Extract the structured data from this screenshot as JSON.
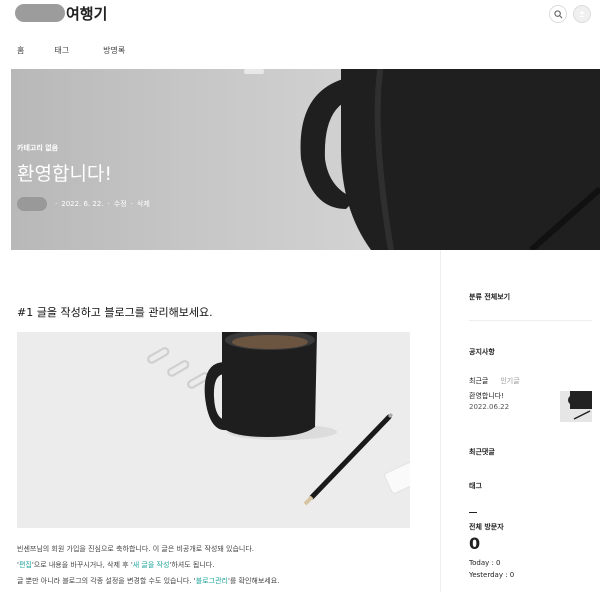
{
  "header": {
    "blog_title": "여행기",
    "search_icon": "search-icon",
    "profile_icon": "profile-icon"
  },
  "nav": {
    "items": [
      "홈",
      "태그",
      "방명록"
    ]
  },
  "hero": {
    "category": "카테고리 없음",
    "title": "환영합니다!",
    "date": "2022. 6. 22.",
    "edit": "수정",
    "delete": "삭제"
  },
  "post": {
    "heading": "#1 글을 작성하고 블로그를 관리해보세요.",
    "line1": "빈센쯔님의 회원 가입을 진심으로 축하합니다. 이 글은 비공개로 작성돼 있습니다.",
    "line2_a": "'",
    "line2_edit": "편집",
    "line2_b": "'으로 내용을 바꾸시거나, 삭제 후 '",
    "line2_new": "새 글을 작성",
    "line2_c": "'하셔도 됩니다.",
    "line3_a": "글 뿐만 아니라 블로그의 각종 설정을 변경할 수도 있습니다. '",
    "line3_manage": "블로그관리",
    "line3_b": "'를 확인해보세요."
  },
  "sidebar": {
    "category_all": "분류 전체보기",
    "notice": "공지사항",
    "tab_recent": "최근글",
    "tab_popular": "인기글",
    "recent_title": "환영합니다!",
    "recent_date": "2022.06.22",
    "recent_comments": "최근댓글",
    "tags": "태그",
    "total_visitors_label": "전체 방문자",
    "total_visitors": "0",
    "today": "Today : 0",
    "yesterday": "Yesterday : 0"
  }
}
